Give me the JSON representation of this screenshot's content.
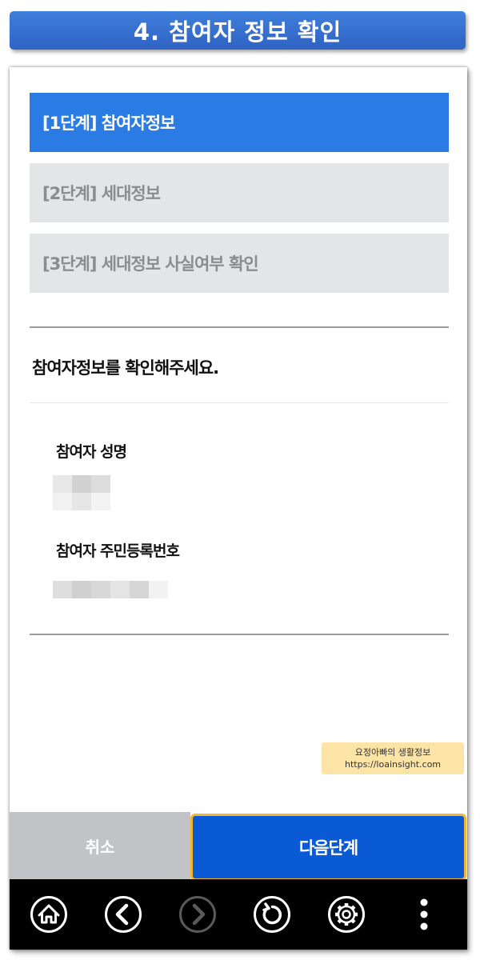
{
  "banner": {
    "title": "4. 참여자 정보 확인"
  },
  "steps": [
    {
      "label": "[1단계] 참여자정보",
      "active": true
    },
    {
      "label": "[2단계] 세대정보",
      "active": false
    },
    {
      "label": "[3단계] 세대정보 사실여부 확인",
      "active": false
    }
  ],
  "instruction": "참여자정보를 확인해주세요.",
  "fields": [
    {
      "label": "참여자 성명",
      "value_masked": true
    },
    {
      "label": "참여자 주민등록번호",
      "value_masked": true
    }
  ],
  "watermark": {
    "line1": "요정아빠의 생활정보",
    "line2": "https://loainsight.com"
  },
  "actions": {
    "cancel_label": "취소",
    "next_label": "다음단계"
  },
  "navbar": {
    "icons": [
      "home-icon",
      "back-icon",
      "forward-icon",
      "refresh-icon",
      "settings-icon",
      "more-icon"
    ]
  },
  "colors": {
    "banner": "#2f63c4",
    "active_step": "#2b7be4",
    "inactive_step": "#e4e5e7",
    "next_button": "#0a5ad6",
    "next_button_border": "#f0b533",
    "cancel_button": "#c1c3c7",
    "navbar": "#000000"
  }
}
